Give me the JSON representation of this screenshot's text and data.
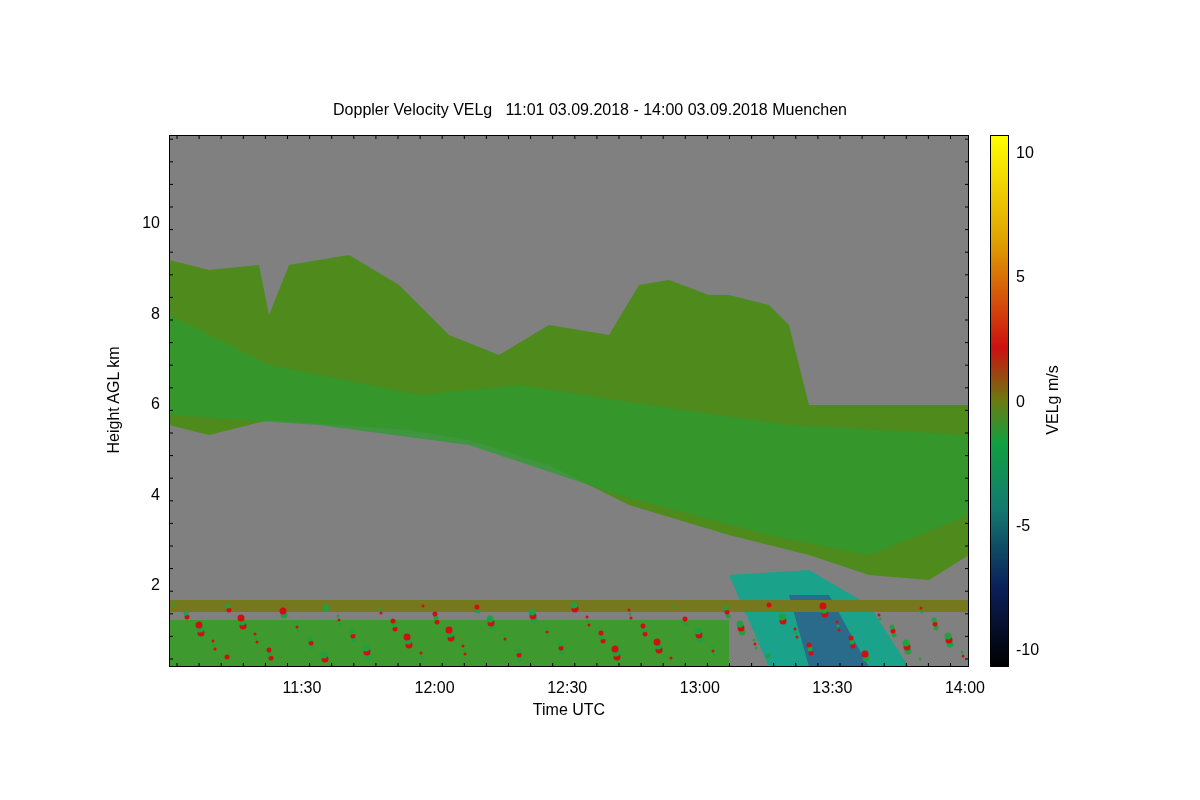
{
  "title": "Doppler Velocity VELg   11:01 03.09.2018 - 14:00 03.09.2018 Muenchen",
  "y_axis": {
    "label": "Height AGL km",
    "ticks": [
      "10",
      "8",
      "6",
      "4",
      "2"
    ]
  },
  "x_axis": {
    "label": "Time UTC",
    "ticks": [
      "11:30",
      "12:00",
      "12:30",
      "13:00",
      "13:30",
      "14:00"
    ]
  },
  "colorbar": {
    "label": "VELg m/s",
    "ticks": [
      "10",
      "5",
      "0",
      "-5",
      "-10"
    ]
  }
}
